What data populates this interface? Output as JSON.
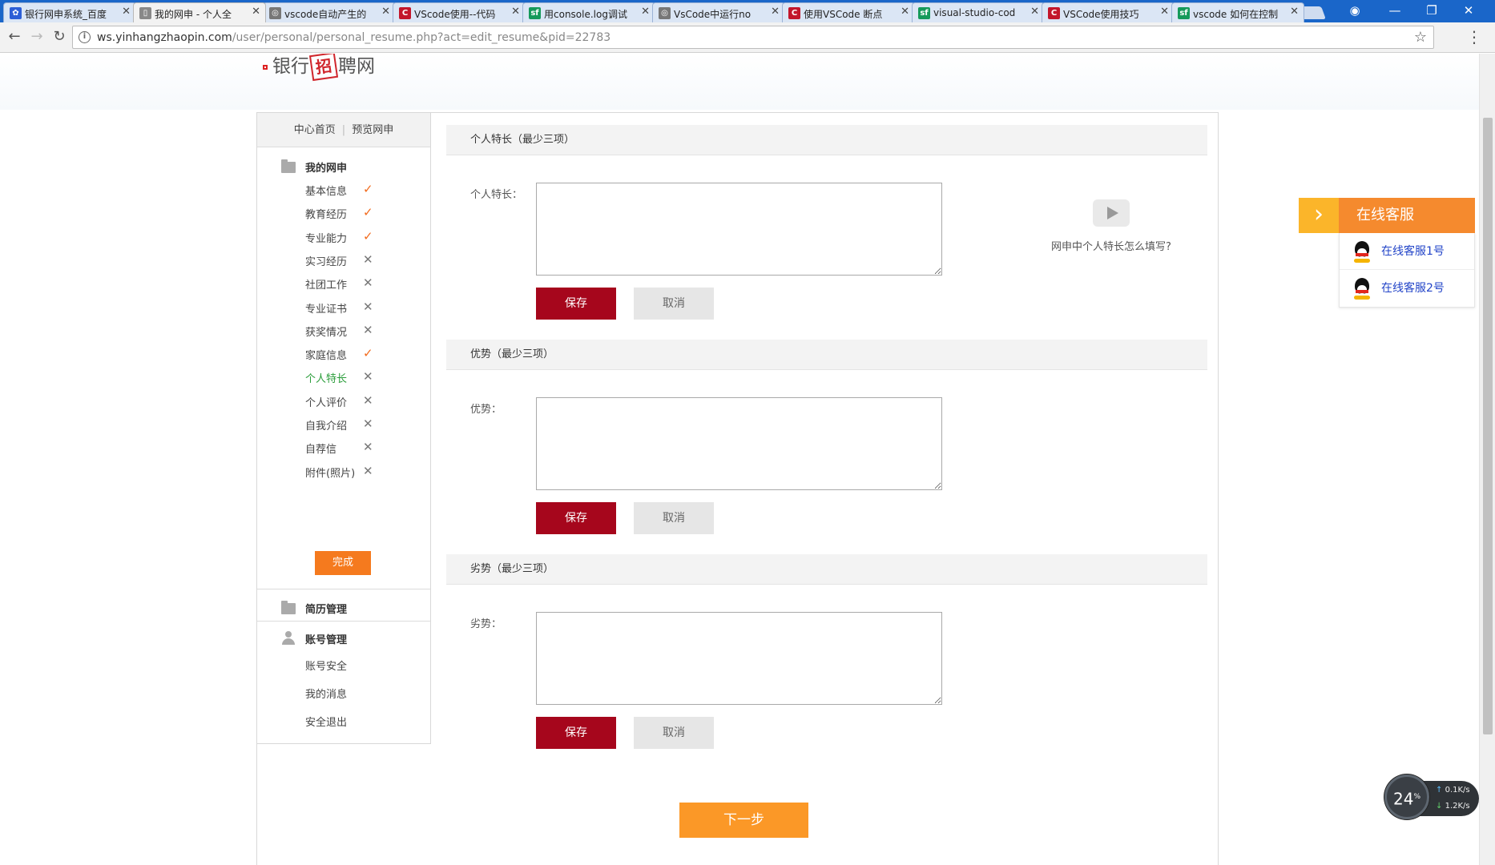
{
  "browser": {
    "tabs": [
      {
        "label": "银行网申系统_百度",
        "favicon": "paw-icon",
        "color": "#2d5fd6"
      },
      {
        "label": "我的网申 - 个人全",
        "favicon": "document-icon",
        "color": "#888888",
        "active": true
      },
      {
        "label": "vscode自动产生的",
        "favicon": "globe-icon",
        "color": "#777777"
      },
      {
        "label": "VScode使用--代码",
        "favicon": "c-icon",
        "color": "#c3162b"
      },
      {
        "label": "用console.log调试",
        "favicon": "sf-icon",
        "color": "#159a5a"
      },
      {
        "label": "VsCode中运行no",
        "favicon": "globe-icon",
        "color": "#777777"
      },
      {
        "label": "使用VSCode 断点",
        "favicon": "c-icon",
        "color": "#c3162b"
      },
      {
        "label": "visual-studio-cod",
        "favicon": "sf-icon",
        "color": "#159a5a"
      },
      {
        "label": "VSCode使用技巧",
        "favicon": "c-icon",
        "color": "#c3162b"
      },
      {
        "label": "vscode 如何在控制",
        "favicon": "sf-icon",
        "color": "#159a5a"
      }
    ],
    "url_host": "ws.yinhangzhaopin.com",
    "url_path": "/user/personal/personal_resume.php?act=edit_resume&pid=22783"
  },
  "logo": {
    "part1": "银行",
    "seal": "招",
    "part2": "聘网"
  },
  "sidebar": {
    "top_links": [
      "中心首页",
      "预览网申"
    ],
    "group_my_apply": "我的网申",
    "items": [
      {
        "label": "基本信息",
        "status": "done"
      },
      {
        "label": "教育经历",
        "status": "done"
      },
      {
        "label": "专业能力",
        "status": "done"
      },
      {
        "label": "实习经历",
        "status": "todo"
      },
      {
        "label": "社团工作",
        "status": "todo"
      },
      {
        "label": "专业证书",
        "status": "todo"
      },
      {
        "label": "获奖情况",
        "status": "todo"
      },
      {
        "label": "家庭信息",
        "status": "done"
      },
      {
        "label": "个人特长",
        "status": "todo",
        "current": true
      },
      {
        "label": "个人评价",
        "status": "todo"
      },
      {
        "label": "自我介绍",
        "status": "todo"
      },
      {
        "label": "自荐信",
        "status": "todo"
      },
      {
        "label": "附件(照片)",
        "status": "todo"
      }
    ],
    "finish_label": "完成",
    "group_resume": "简历管理",
    "group_account": "账号管理",
    "account_items": [
      "账号安全",
      "我的消息",
      "安全退出"
    ]
  },
  "sections": [
    {
      "title": "个人特长（最少三项）",
      "label": "个人特长：",
      "save": "保存",
      "cancel": "取消"
    },
    {
      "title": "优势（最少三项）",
      "label": "优势：",
      "save": "保存",
      "cancel": "取消"
    },
    {
      "title": "劣势（最少三项）",
      "label": "劣势：",
      "save": "保存",
      "cancel": "取消"
    }
  ],
  "video_help": "网申中个人特长怎么填写?",
  "next_step": "下一步",
  "service": {
    "title": "在线客服",
    "items": [
      "在线客服1号",
      "在线客服2号"
    ]
  },
  "netmon": {
    "percent": "24",
    "percent_unit": "%",
    "up": "0.1",
    "down": "1.2",
    "unit": "K/s"
  },
  "colors": {
    "brand_red": "#a6061c",
    "accent_orange": "#f57a1e",
    "done_check": "#f26b1d",
    "current_green": "#2a9d3a",
    "link_blue": "#2244c8"
  }
}
